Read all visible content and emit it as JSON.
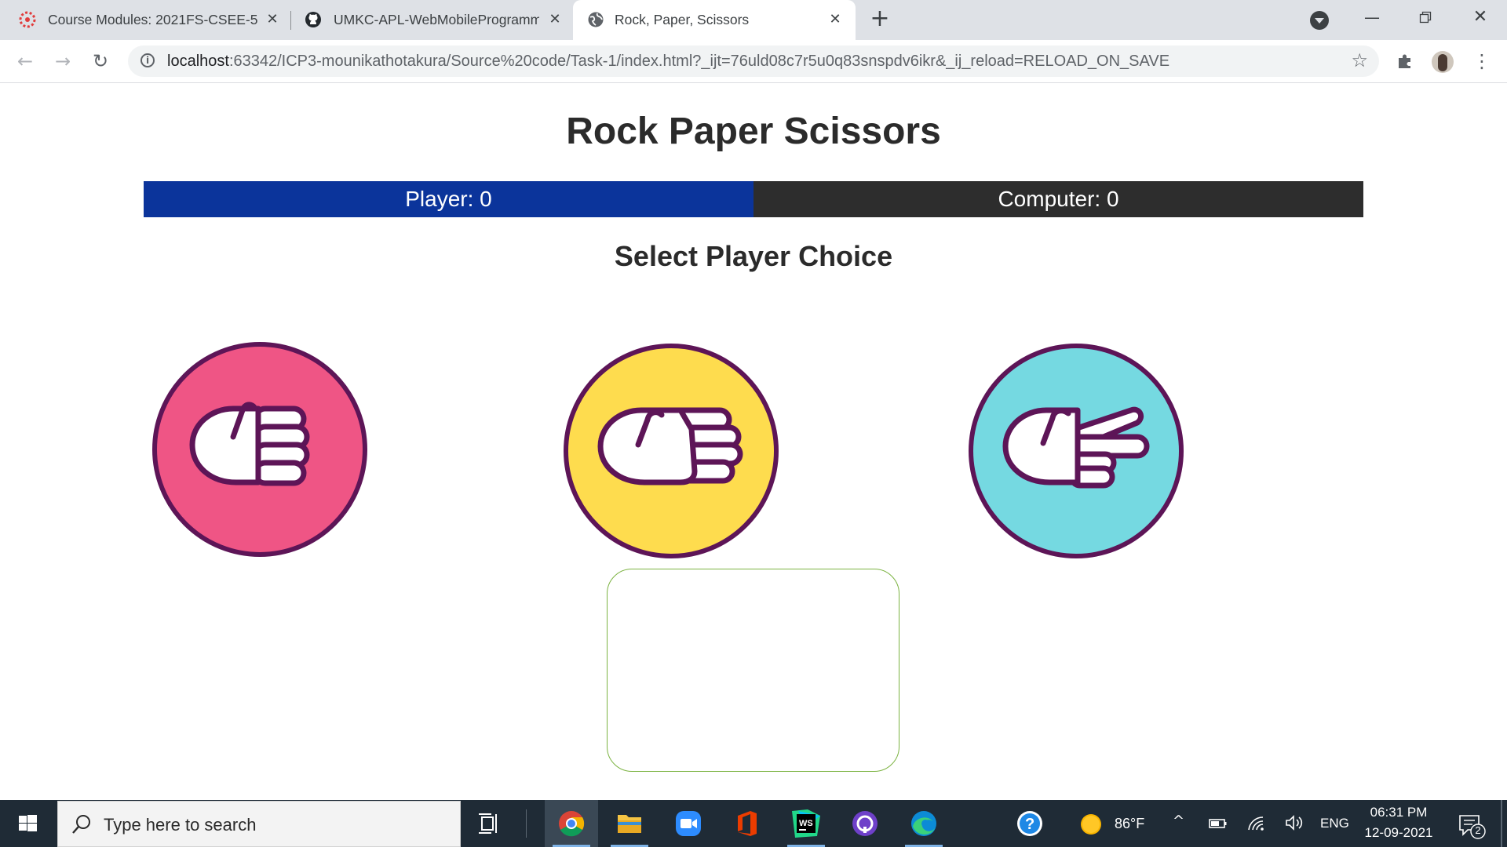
{
  "browser": {
    "tabs": [
      {
        "title": "Course Modules: 2021FS-CSEE-5",
        "icon": "canvas-lms-icon"
      },
      {
        "title": "UMKC-APL-WebMobileProgramm",
        "icon": "github-icon"
      },
      {
        "title": "Rock, Paper, Scissors",
        "icon": "globe-icon",
        "active": true
      }
    ],
    "url_host": "localhost",
    "url_rest": ":63342/ICP3-mounikathotakura/Source%20code/Task-1/index.html?_ijt=76uld08c7r5u0q83snspdv6ikr&_ij_reload=RELOAD_ON_SAVE"
  },
  "page": {
    "title": "Rock Paper Scissors",
    "player_score": "Player: 0",
    "computer_score": "Computer: 0",
    "subtitle": "Select Player Choice",
    "choices": [
      {
        "name": "rock",
        "color": "#ef5585"
      },
      {
        "name": "paper",
        "color": "#fedc4e"
      },
      {
        "name": "scissors",
        "color": "#75d9e1"
      }
    ],
    "result": ""
  },
  "colors": {
    "player_bar": "#0b349b",
    "computer_bar": "#2d2d2d",
    "outline": "#5d1557",
    "result_border": "#7cb342"
  },
  "taskbar": {
    "search_placeholder": "Type here to search",
    "weather": "86°F",
    "language": "ENG",
    "time": "06:31 PM",
    "date": "12-09-2021",
    "notifications": "2"
  }
}
